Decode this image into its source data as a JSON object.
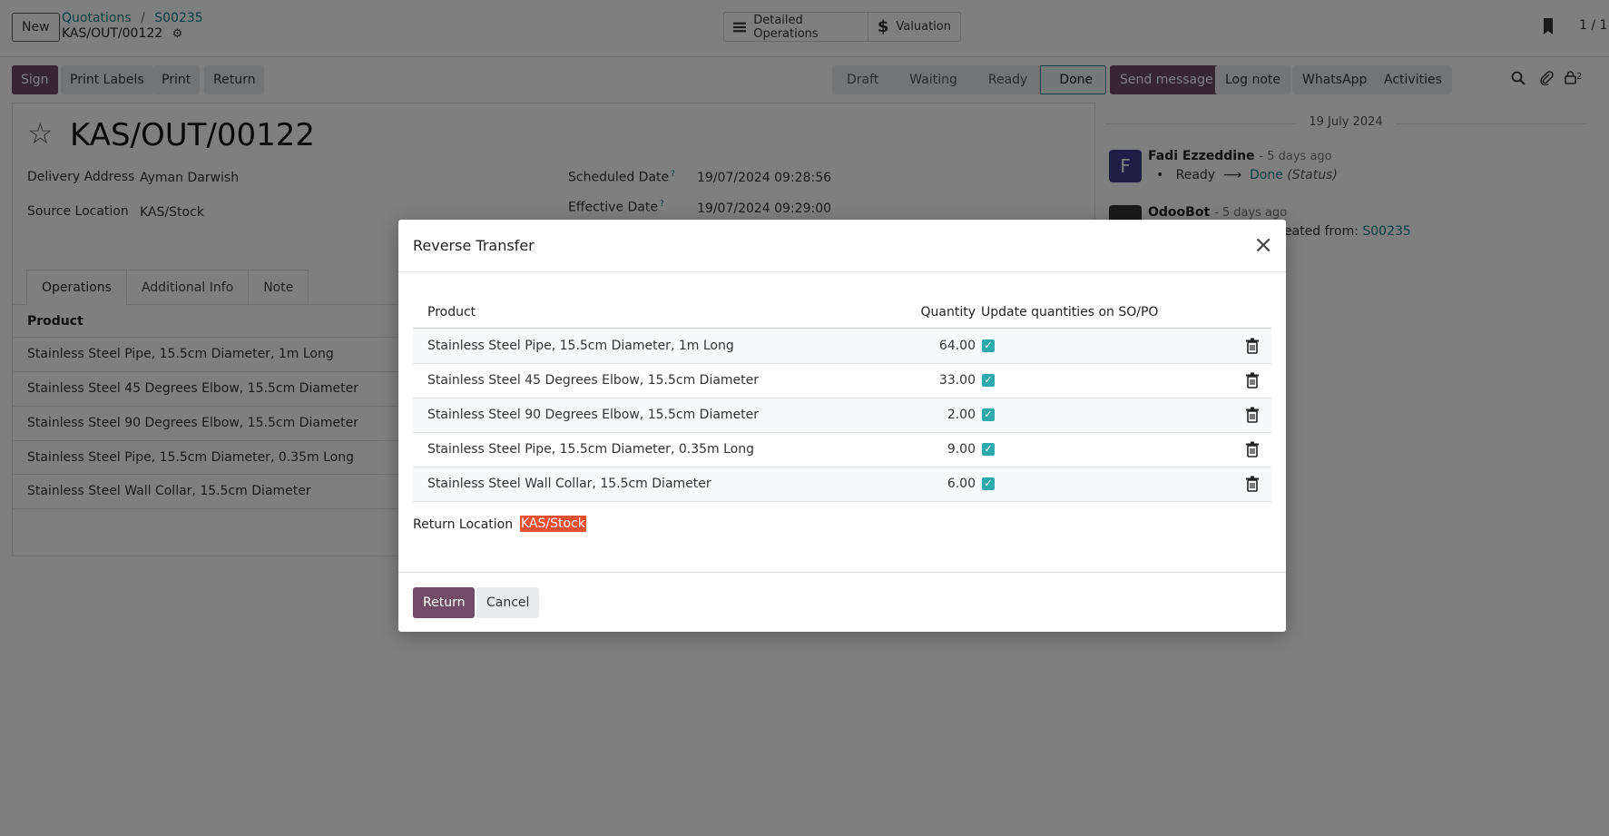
{
  "header": {
    "new_label": "New",
    "breadcrumb": [
      "Quotations",
      "S00235"
    ],
    "breadcrumb_sep": "/",
    "record_name": "KAS/OUT/00122",
    "smart_buttons": [
      {
        "label": "Detailed Operations",
        "icon": "list-icon"
      },
      {
        "label": "Valuation",
        "icon": "dollar-icon"
      }
    ],
    "pager": "1 / 1"
  },
  "actions": {
    "sign": "Sign",
    "print_labels": "Print Labels",
    "print": "Print",
    "return": "Return"
  },
  "status": {
    "stages": [
      "Draft",
      "Waiting",
      "Ready",
      "Done"
    ],
    "current": "Done"
  },
  "form": {
    "title": "KAS/OUT/00122",
    "delivery_address_label": "Delivery Address",
    "delivery_address": "Ayman Darwish",
    "source_location_label": "Source Location",
    "source_location": "KAS/Stock",
    "scheduled_date_label": "Scheduled Date",
    "scheduled_date": "19/07/2024 09:28:56",
    "effective_date_label": "Effective Date",
    "effective_date": "19/07/2024 09:29:00",
    "help_mark": "?",
    "tabs": [
      "Operations",
      "Additional Info",
      "Note"
    ],
    "product_header": "Product",
    "products": [
      "Stainless Steel Pipe, 15.5cm Diameter, 1m Long",
      "Stainless Steel 45 Degrees Elbow, 15.5cm Diameter",
      "Stainless Steel 90 Degrees Elbow, 15.5cm Diameter",
      "Stainless Steel Pipe, 15.5cm Diameter, 0.35m Long",
      "Stainless Steel Wall Collar, 15.5cm Diameter"
    ]
  },
  "chatter": {
    "buttons": [
      "Send message",
      "Log note",
      "WhatsApp",
      "Activities"
    ],
    "follower_count": "2",
    "date": "19 July 2024",
    "messages": [
      {
        "initial": "F",
        "author": "Fadi Ezzeddine",
        "time": "- 5 days ago",
        "from": "Ready",
        "to": "Done",
        "field": "(Status)"
      },
      {
        "author": "OdooBot",
        "time": "- 5 days ago",
        "text_fragment": "eated from:",
        "link": "S00235"
      }
    ]
  },
  "dialog": {
    "title": "Reverse Transfer",
    "columns": [
      "Product",
      "Quantity",
      "Update quantities on SO/PO"
    ],
    "rows": [
      {
        "product": "Stainless Steel Pipe, 15.5cm Diameter, 1m Long",
        "quantity": "64.00",
        "update": true
      },
      {
        "product": "Stainless Steel 45 Degrees Elbow, 15.5cm Diameter",
        "quantity": "33.00",
        "update": true
      },
      {
        "product": "Stainless Steel 90 Degrees Elbow, 15.5cm Diameter",
        "quantity": "2.00",
        "update": true
      },
      {
        "product": "Stainless Steel Pipe, 15.5cm Diameter, 0.35m Long",
        "quantity": "9.00",
        "update": true
      },
      {
        "product": "Stainless Steel Wall Collar, 15.5cm Diameter",
        "quantity": "6.00",
        "update": true
      }
    ],
    "return_location_label": "Return Location",
    "return_location": "KAS/Stock",
    "return_button": "Return",
    "cancel_button": "Cancel"
  },
  "colors": {
    "brand": "#714b67",
    "link": "#017e84",
    "checkbox": "#2eaaaf",
    "highlight": "#e8502f"
  }
}
